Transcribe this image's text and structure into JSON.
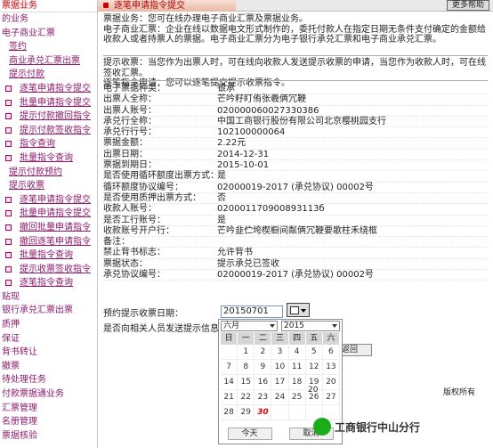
{
  "sidebar": {
    "header": "票据业务",
    "items": [
      {
        "label": "的业务",
        "level": 0
      },
      {
        "label": "电子商业汇票",
        "level": 0
      },
      {
        "label": "签约",
        "level": 1
      },
      {
        "label": "商业承兑汇票出票",
        "level": 1
      },
      {
        "label": "提示付款",
        "level": 1
      },
      {
        "label": "逐笔申请指令提交",
        "level": 2
      },
      {
        "label": "批量申请指令提交",
        "level": 2
      },
      {
        "label": "提示付款撤回指令",
        "level": 2
      },
      {
        "label": "提示付款签收指令",
        "level": 2
      },
      {
        "label": "指令查询",
        "level": 2
      },
      {
        "label": "批量指令查询",
        "level": 2
      },
      {
        "label": "提示付款预约",
        "level": 1
      },
      {
        "label": "提示收票",
        "level": 1
      },
      {
        "label": "逐笔申请指令提交",
        "level": 2
      },
      {
        "label": "批量申请指令提交",
        "level": 2
      },
      {
        "label": "撤回批量申请指令",
        "level": 2
      },
      {
        "label": "撤回逐笔申请指令",
        "level": 2
      },
      {
        "label": "批量指令查询",
        "level": 2
      },
      {
        "label": "提示收票签收指令",
        "level": 2
      },
      {
        "label": "逐笔指令查询",
        "level": 2
      },
      {
        "label": "贴现",
        "level": 0
      },
      {
        "label": "银行承兑汇票出票",
        "level": 0
      },
      {
        "label": "质押",
        "level": 0
      },
      {
        "label": "保证",
        "level": 0
      },
      {
        "label": "背书转让",
        "level": 0
      },
      {
        "label": "撤票",
        "level": 0
      },
      {
        "label": "待处理任务",
        "level": 0
      },
      {
        "label": "付款票据通业务",
        "level": 0
      },
      {
        "label": "汇票管理",
        "level": 0
      },
      {
        "label": "名册管理",
        "level": 0
      },
      {
        "label": "票据核验",
        "level": 0
      }
    ]
  },
  "topbar": {
    "tab": "逐笔申请指令提交",
    "more": "更多帮助"
  },
  "notice": {
    "line1": "票据业务：您可在线办理电子商业汇票及票据业务。",
    "line2": "电子商业汇票：企业在线以数据电文形式制作的，委托付款人在指定日期无条件支付确定的金额给收款人或者持票人的票据。电子商业汇票分为电子银行承兑汇票和电子商业承兑汇票。",
    "hint1": "提示收票：当您作为出票人时，可在线向收款人发送提示收票的申请，当您作为收款人时，可在线签收汇票。",
    "hint2": "逐笔指令申请：您可以逐笔提交提示收票指令。"
  },
  "form": {
    "rows": [
      {
        "label": "电子票据种类：",
        "value": "银承"
      },
      {
        "label": "出票人全称：",
        "value": "芒吟籽盯侑张羲俩冗鞭"
      },
      {
        "label": "出票人账号：",
        "value": "020000060027330386"
      },
      {
        "label": "承兑行全称：",
        "value": "中国工商银行股份有限公司北京樱桃园支行"
      },
      {
        "label": "承兑行行号：",
        "value": "102100000064"
      },
      {
        "label": "票据金额：",
        "value": "2.22元"
      },
      {
        "label": "出票日期：",
        "value": "2014-12-31"
      },
      {
        "label": "票据到期日：",
        "value": "2015-10-01"
      },
      {
        "label": "是否使用循环额度出票方式：",
        "value": "是"
      },
      {
        "label": "循环额度协议编号：",
        "value": "02000019-2017 (承兑协议) 00002号"
      },
      {
        "label": "是否使用质押出票方式：",
        "value": "否"
      },
      {
        "label": "收款人账号：",
        "value": "020001170900893113б"
      },
      {
        "label": "是否工行账号：",
        "value": "是"
      },
      {
        "label": "收款账号开户行：",
        "value": "芒吟韭伫垮楔橱间粼俩冗鞭要歌柱禾绕框"
      },
      {
        "label": "备注：",
        "value": ""
      },
      {
        "label": "禁止背书标志：",
        "value": "允许背书"
      },
      {
        "label": "票据状态：",
        "value": "提示承兑已签收"
      },
      {
        "label": "承兑协议编号：",
        "value": "02000019-2017 (承兑协议) 00002号"
      }
    ],
    "date_label": "预约提示收票日期：",
    "date_value": "20150701",
    "send_label": "是否向相关人员发送提示信息：",
    "submit": "返回"
  },
  "calendar": {
    "month": "六月",
    "year": "2015",
    "weekdays": [
      "日",
      "一",
      "二",
      "三",
      "四",
      "五",
      "六"
    ],
    "days": [
      "",
      "1",
      "2",
      "3",
      "4",
      "5",
      "6",
      "7",
      "8",
      "9",
      "10",
      "11",
      "12",
      "13",
      "14",
      "15",
      "16",
      "17",
      "18",
      "19",
      "20",
      "21",
      "22",
      "23",
      "24",
      "25",
      "26",
      "27",
      "28",
      "29",
      "30",
      "",
      "",
      "",
      ""
    ],
    "today": "今天",
    "cancel": "取消"
  },
  "footer": {
    "copy_left": "20",
    "copy_right": "版权所有"
  },
  "watermark": "工商银行中山分行"
}
